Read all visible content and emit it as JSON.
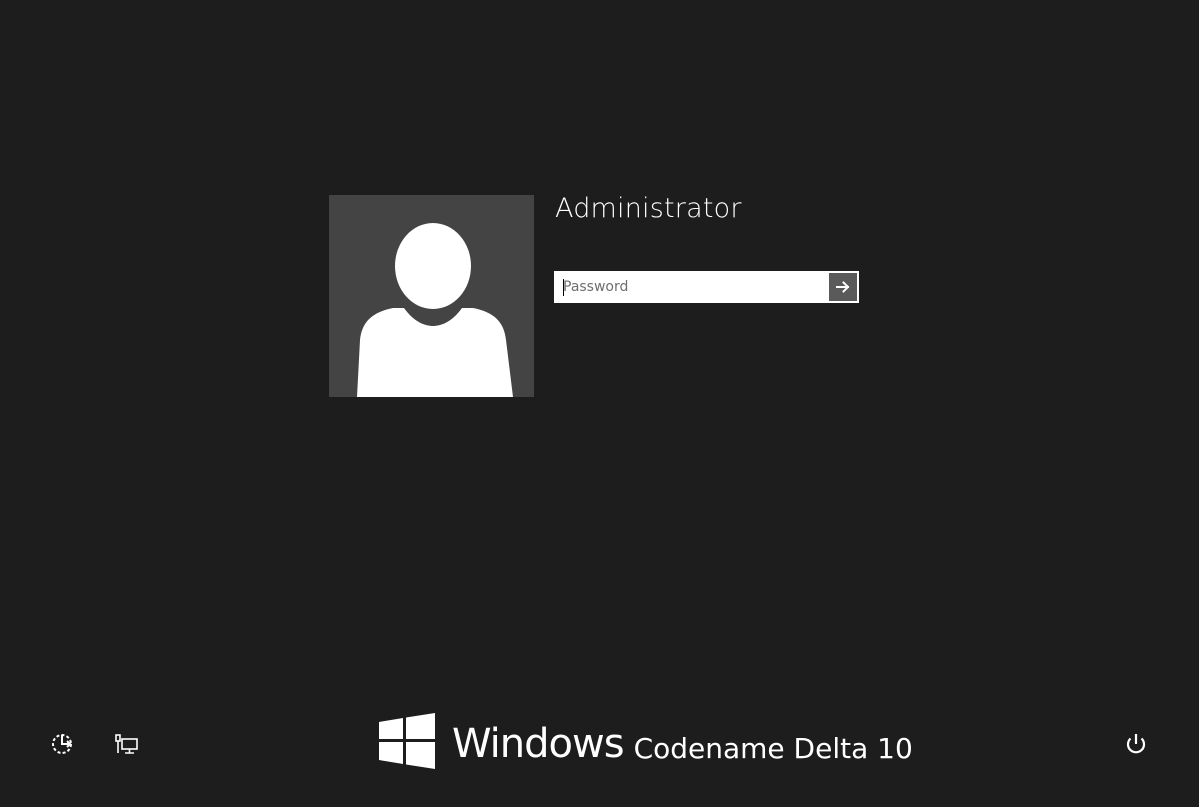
{
  "login": {
    "user_name": "Administrator",
    "password_placeholder": "Password",
    "password_value": ""
  },
  "submit": {
    "icon": "arrow-right-icon"
  },
  "bottom_bar": {
    "ease_of_access_icon": "ease-of-access-icon",
    "network_icon": "network-icon",
    "power_icon": "power-icon"
  },
  "brand": {
    "windows": "Windows",
    "edition": "Codename Delta 10"
  },
  "colors": {
    "background": "#1d1d1d",
    "avatar_tile": "#444444",
    "submit_button": "#5a5a5a",
    "foreground": "#ffffff"
  }
}
